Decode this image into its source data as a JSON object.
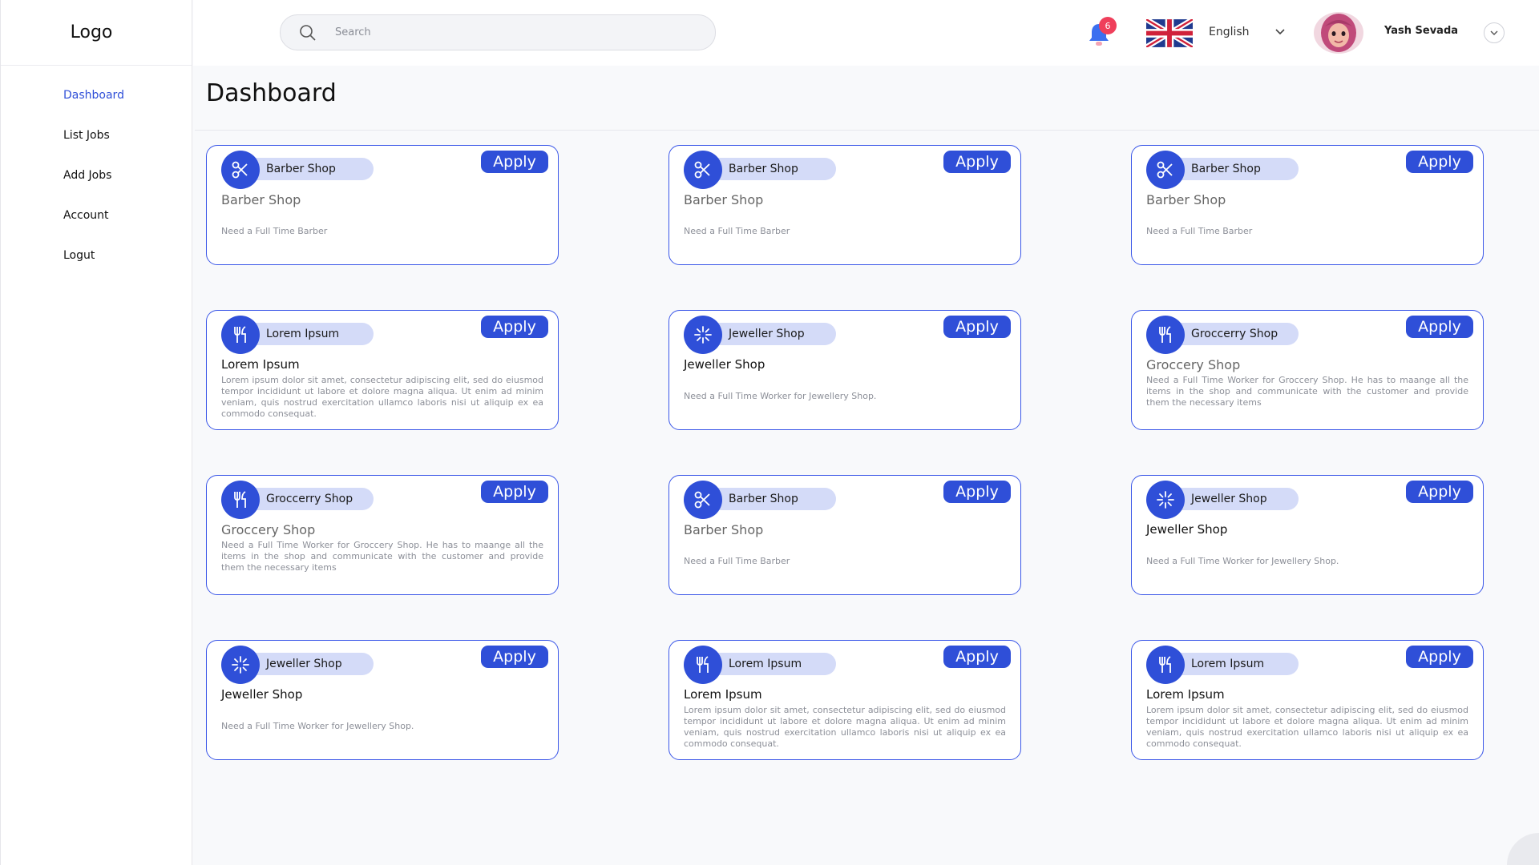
{
  "sidebar": {
    "logo": "Logo",
    "items": [
      {
        "label": "Dashboard",
        "active": true
      },
      {
        "label": "List Jobs"
      },
      {
        "label": "Add Jobs"
      },
      {
        "label": "Account"
      },
      {
        "label": "Logut"
      }
    ]
  },
  "header": {
    "search_placeholder": "Search",
    "notifications_count": "6",
    "language": "English",
    "user_name": "Yash Sevada"
  },
  "main": {
    "title": "Dashboard",
    "apply_label": "Apply",
    "cards": [
      {
        "category": "Barber Shop",
        "icon": "scissors-icon",
        "title": "Barber Shop",
        "title_style": "grey",
        "desc": "Need a Full Time Barber",
        "desc_style": "short"
      },
      {
        "category": "Barber Shop",
        "icon": "scissors-icon",
        "title": "Barber Shop",
        "title_style": "grey",
        "desc": "Need a Full Time Barber",
        "desc_style": "short"
      },
      {
        "category": "Barber Shop",
        "icon": "scissors-icon",
        "title": "Barber Shop",
        "title_style": "grey",
        "desc": "Need a Full Time Barber",
        "desc_style": "short"
      },
      {
        "category": "Lorem Ipsum",
        "icon": "utensils-icon",
        "title": "Lorem Ipsum",
        "title_style": "dark",
        "desc": "Lorem ipsum dolor sit amet, consectetur adipiscing elit, sed do eiusmod tempor incididunt ut labore et dolore magna aliqua. Ut enim ad minim veniam, quis nostrud exercitation ullamco laboris nisi ut aliquip ex ea commodo consequat.",
        "desc_style": "long"
      },
      {
        "category": "Jeweller Shop",
        "icon": "sparkle-icon",
        "title": "Jeweller Shop",
        "title_style": "dark",
        "desc": "Need a Full Time Worker for Jewellery Shop.",
        "desc_style": "short"
      },
      {
        "category": "Groccerry Shop",
        "icon": "utensils-icon",
        "title": "Groccery Shop",
        "title_style": "grey",
        "desc": "Need a Full Time Worker for Groccery Shop. He has to maange all the items in the shop and communicate with the customer and provide them the necessary  items",
        "desc_style": "long"
      },
      {
        "category": "Groccerry Shop",
        "icon": "utensils-icon",
        "title": "Groccery Shop",
        "title_style": "grey",
        "desc": "Need a Full Time Worker for Groccery Shop. He has to maange all the items in the shop and communicate with the customer and provide them the necessary  items",
        "desc_style": "long"
      },
      {
        "category": "Barber Shop",
        "icon": "scissors-icon",
        "title": "Barber Shop",
        "title_style": "grey",
        "desc": "Need a Full Time Barber",
        "desc_style": "short"
      },
      {
        "category": "Jeweller Shop",
        "icon": "sparkle-icon",
        "title": "Jeweller Shop",
        "title_style": "dark",
        "desc": "Need a Full Time Worker for Jewellery Shop.",
        "desc_style": "short"
      },
      {
        "category": "Jeweller Shop",
        "icon": "sparkle-icon",
        "title": "Jeweller Shop",
        "title_style": "dark",
        "desc": "Need a Full Time Worker for Jewellery Shop.",
        "desc_style": "short"
      },
      {
        "category": "Lorem Ipsum",
        "icon": "utensils-icon",
        "title": "Lorem Ipsum",
        "title_style": "dark",
        "desc": "Lorem ipsum dolor sit amet, consectetur adipiscing elit, sed do eiusmod tempor incididunt ut labore et dolore magna aliqua. Ut enim ad minim veniam, quis nostrud exercitation ullamco laboris nisi ut aliquip ex ea commodo consequat.",
        "desc_style": "long"
      },
      {
        "category": "Lorem Ipsum",
        "icon": "utensils-icon",
        "title": "Lorem Ipsum",
        "title_style": "dark",
        "desc": "Lorem ipsum dolor sit amet, consectetur adipiscing elit, sed do eiusmod tempor incididunt ut labore et dolore magna aliqua. Ut enim ad minim veniam, quis nostrud exercitation ullamco laboris nisi ut aliquip ex ea commodo consequat.",
        "desc_style": "long"
      }
    ]
  },
  "colors": {
    "accent": "#2f4fd8",
    "pill": "#d4dbf8",
    "badge": "#ef3f5b"
  }
}
